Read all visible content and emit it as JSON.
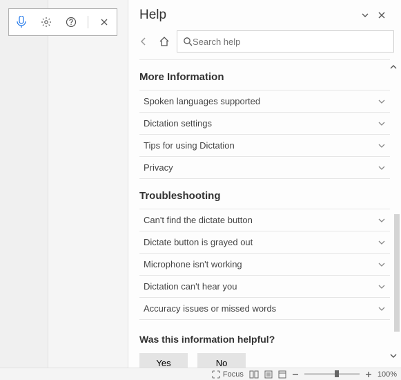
{
  "floatbar": {},
  "help": {
    "title": "Help",
    "search_placeholder": "Search help",
    "section1_title": "More Information",
    "section1_items": [
      "Spoken languages supported",
      "Dictation settings",
      "Tips for using Dictation",
      "Privacy"
    ],
    "section2_title": "Troubleshooting",
    "section2_items": [
      "Can't find the dictate button",
      "Dictate button is grayed out",
      "Microphone isn't working",
      "Dictation can't hear you",
      "Accuracy issues or missed words"
    ],
    "helpful_q": "Was this information helpful?",
    "yes": "Yes",
    "no": "No"
  },
  "statusbar": {
    "focus": "Focus",
    "zoom": "100%"
  }
}
